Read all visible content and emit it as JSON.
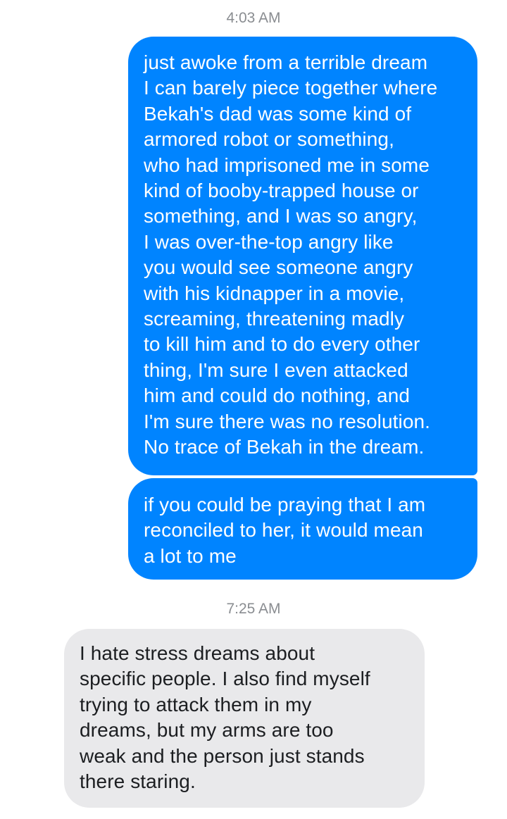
{
  "thread": {
    "groups": [
      {
        "timestamp": "4:03 AM",
        "messages": [
          {
            "direction": "sent",
            "text": "just awoke from a terrible dream\nI can barely piece together where\nBekah's dad was some kind of\narmored robot or something,\nwho had imprisoned me in some\nkind of booby-trapped house or\nsomething, and I was so angry,\nI was over-the-top angry like\nyou would see someone angry\nwith his kidnapper in a movie,\nscreaming, threatening madly\nto kill him and to do every other\nthing, I'm sure I even attacked\nhim and could do nothing, and\nI'm sure there was no resolution.\nNo trace of Bekah in the dream."
          },
          {
            "direction": "sent",
            "text": "if you could be praying that I am\nreconciled to her, it would mean\na lot to me"
          }
        ]
      },
      {
        "timestamp": "7:25 AM",
        "messages": [
          {
            "direction": "received",
            "text": "I hate stress dreams about\nspecific people. I also find myself\ntrying to attack them in my\ndreams, but my arms are too\nweak and the person just stands\nthere staring."
          }
        ]
      }
    ]
  },
  "colors": {
    "sent_bubble": "#0084ff",
    "sent_text": "#ffffff",
    "received_bubble": "#e9e9eb",
    "received_text": "#1c1e21",
    "timestamp_text": "#8a8d91",
    "background": "#ffffff"
  }
}
